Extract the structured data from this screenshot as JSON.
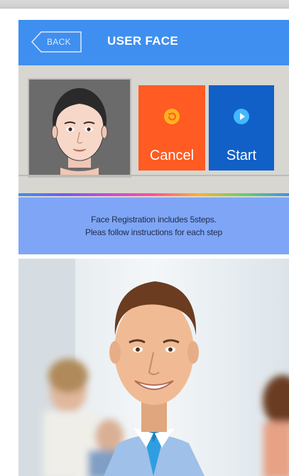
{
  "header": {
    "back_label": "BACK",
    "title": "USER FACE"
  },
  "actions": {
    "cancel_label": "Cancel",
    "start_label": "Start"
  },
  "info": {
    "line1": "Face Registration includes 5steps.",
    "line2": "Pleas follow instructions for each step"
  },
  "colors": {
    "header": "#3f8ff0",
    "cancel": "#ff5b22",
    "start": "#1160c8",
    "info_bar": "#7fa6f6"
  },
  "icons": {
    "back": "back-arrow-icon",
    "cancel": "refresh-icon",
    "start": "play-icon"
  }
}
